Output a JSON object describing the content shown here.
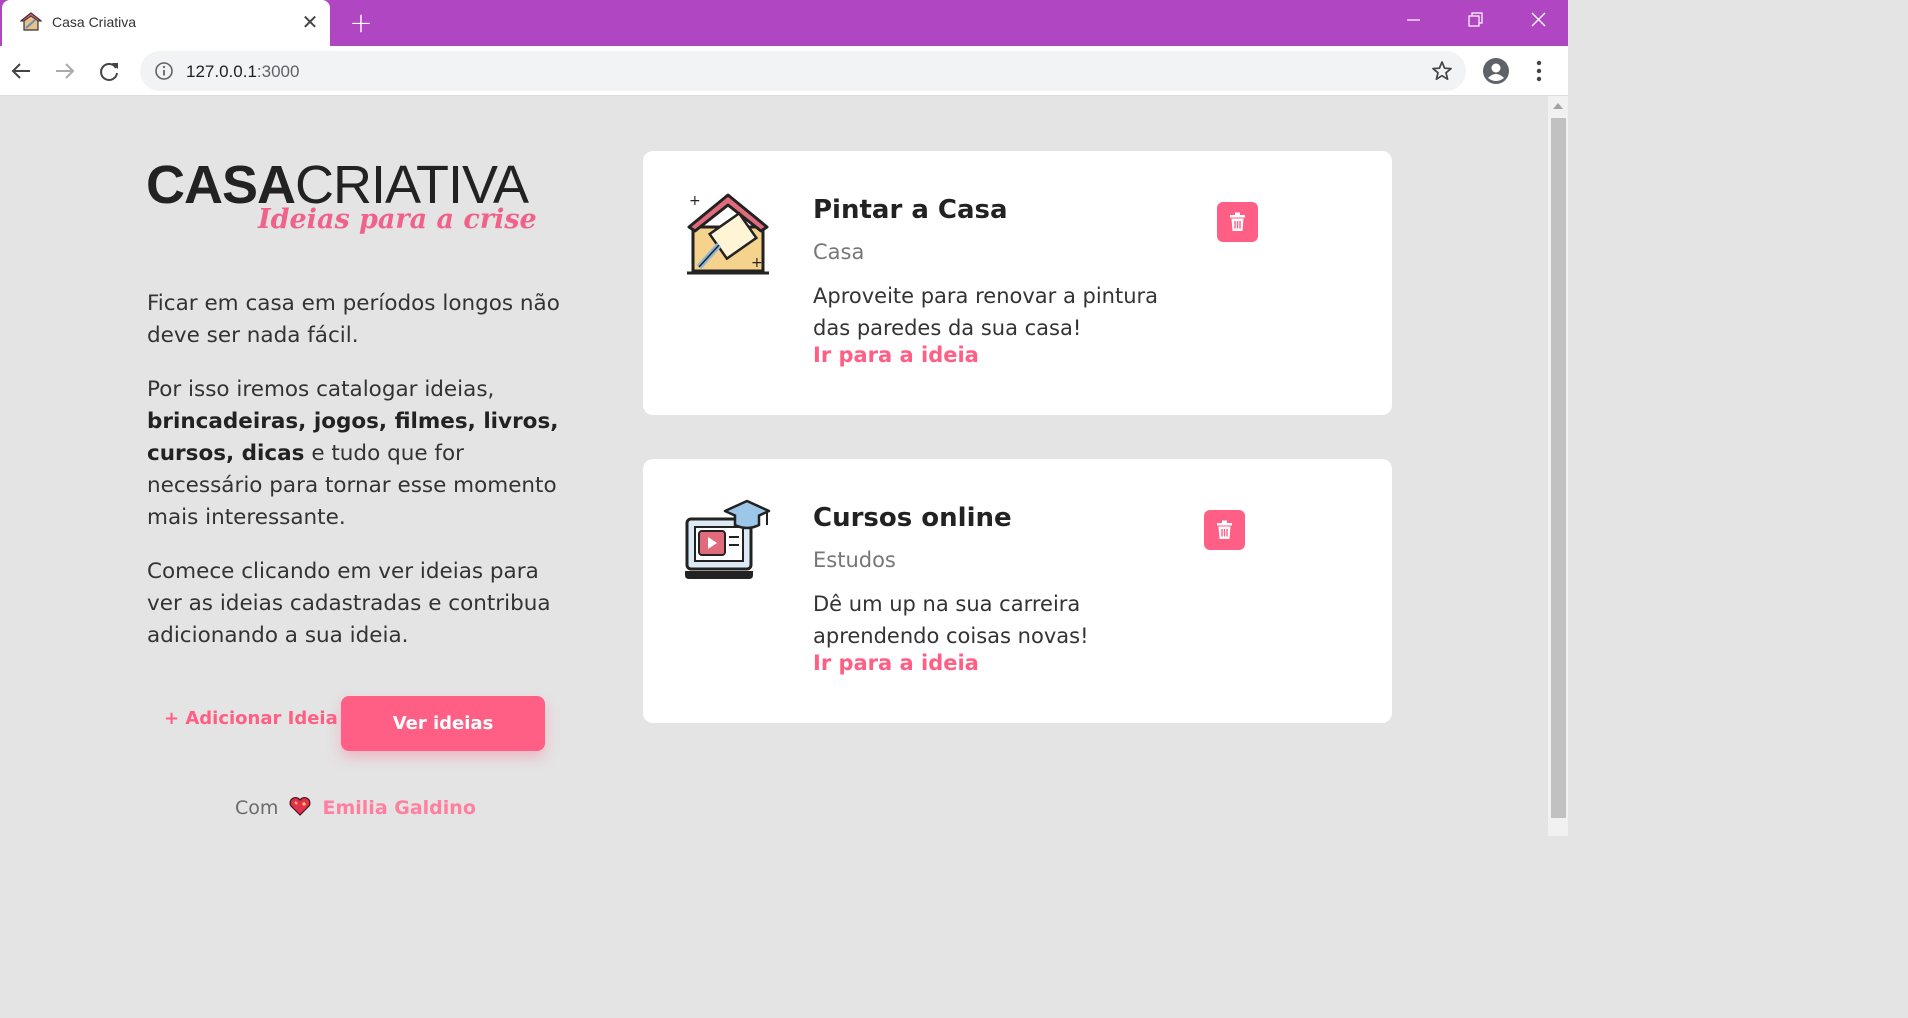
{
  "browser": {
    "tab_title": "Casa Criativa",
    "new_tab_symbol": "+",
    "url_host": "127.0.0.1",
    "url_port": ":3000",
    "icons": [
      "house-favicon-icon",
      "close-icon",
      "plus-icon",
      "minimize-icon",
      "restore-icon",
      "window-close-icon",
      "back-icon",
      "forward-icon",
      "reload-icon",
      "info-icon",
      "star-icon",
      "profile-icon",
      "kebab-menu-icon"
    ]
  },
  "logo": {
    "main_bold": "CASA",
    "main_light": "CRIATIVA",
    "tagline": "Ideias para a crise"
  },
  "intro": {
    "p1": "Ficar em casa em períodos longos não deve ser nada fácil.",
    "p2_start": "Por isso iremos catalogar ideias, ",
    "p2_bold": "brincadeiras, jogos, filmes, livros, cursos, dicas",
    "p2_end": " e tudo que for necessário para tornar esse momento mais interessante.",
    "p3": "Comece clicando em ver ideias para ver as ideias cadastradas e contribua adicionando a sua ideia."
  },
  "actions": {
    "add_label": "+ Adicionar Ideia",
    "view_label": "Ver ideias"
  },
  "credits": {
    "prefix": "Com",
    "author": "Emilia Galdino"
  },
  "ideas": [
    {
      "title": "Pintar a Casa",
      "category": "Casa",
      "description": "Aproveite para renovar a pintura das paredes da sua casa!",
      "link": "Ir para a ideia",
      "icon": "paint-house-icon"
    },
    {
      "title": "Cursos online",
      "category": "Estudos",
      "description": "Dê um up na sua carreira aprendendo coisas novas!",
      "link": "Ir para a ideia",
      "icon": "online-course-icon"
    }
  ],
  "colors": {
    "accent": "#ff5f84",
    "titlebar": "#b046c2",
    "background": "#e4e4e4"
  }
}
